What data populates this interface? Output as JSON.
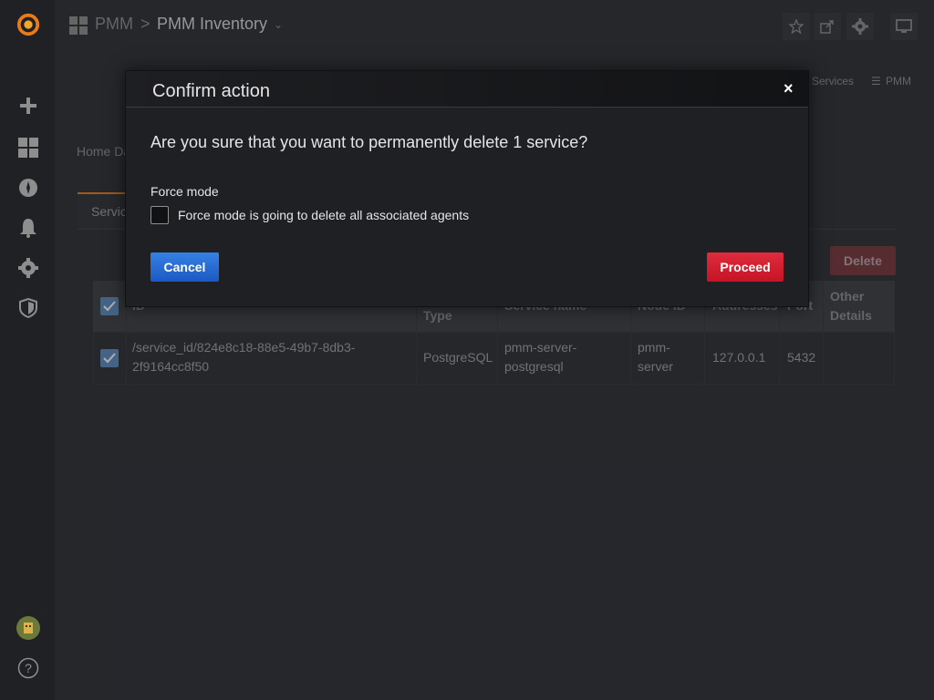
{
  "header": {
    "breadcrumb_root": "PMM",
    "breadcrumb_sep": ">",
    "title": "PMM Inventory",
    "links": [
      "Services",
      "PMM"
    ]
  },
  "page": {
    "home_text": "Home Da",
    "tab_label": "Servic",
    "delete_label": "Delete"
  },
  "table": {
    "headers": [
      "ID",
      "Type",
      "Service name",
      "Node ID",
      "Addresses",
      "Port",
      "Other Details"
    ],
    "rows": [
      {
        "id_line1": "/service_id/824e8c18-88e5-49b7-8db3-",
        "id_line2": "2f9164cc8f50",
        "type": "PostgreSQL",
        "name_line1": "pmm-server-",
        "name_line2": "postgresql",
        "node_line1": "pmm-",
        "node_line2": "server",
        "address": "127.0.0.1",
        "port": "5432",
        "details": ""
      }
    ]
  },
  "modal": {
    "title": "Confirm action",
    "close": "×",
    "question": "Are you sure that you want to permanently delete 1 service?",
    "force_label": "Force mode",
    "force_text": "Force mode is going to delete all associated agents",
    "cancel": "Cancel",
    "proceed": "Proceed"
  },
  "colors": {
    "accent": "#eb7b18",
    "primary": "#1d58c4",
    "danger": "#c41426"
  },
  "icons": [
    "grafana-logo-icon",
    "plus-icon",
    "dashboards-icon",
    "explore-icon",
    "bell-icon",
    "gear-icon",
    "shield-icon",
    "avatar",
    "help-icon",
    "star-icon",
    "share-icon",
    "settings-icon",
    "tv-icon",
    "menu-icon",
    "check-icon"
  ]
}
